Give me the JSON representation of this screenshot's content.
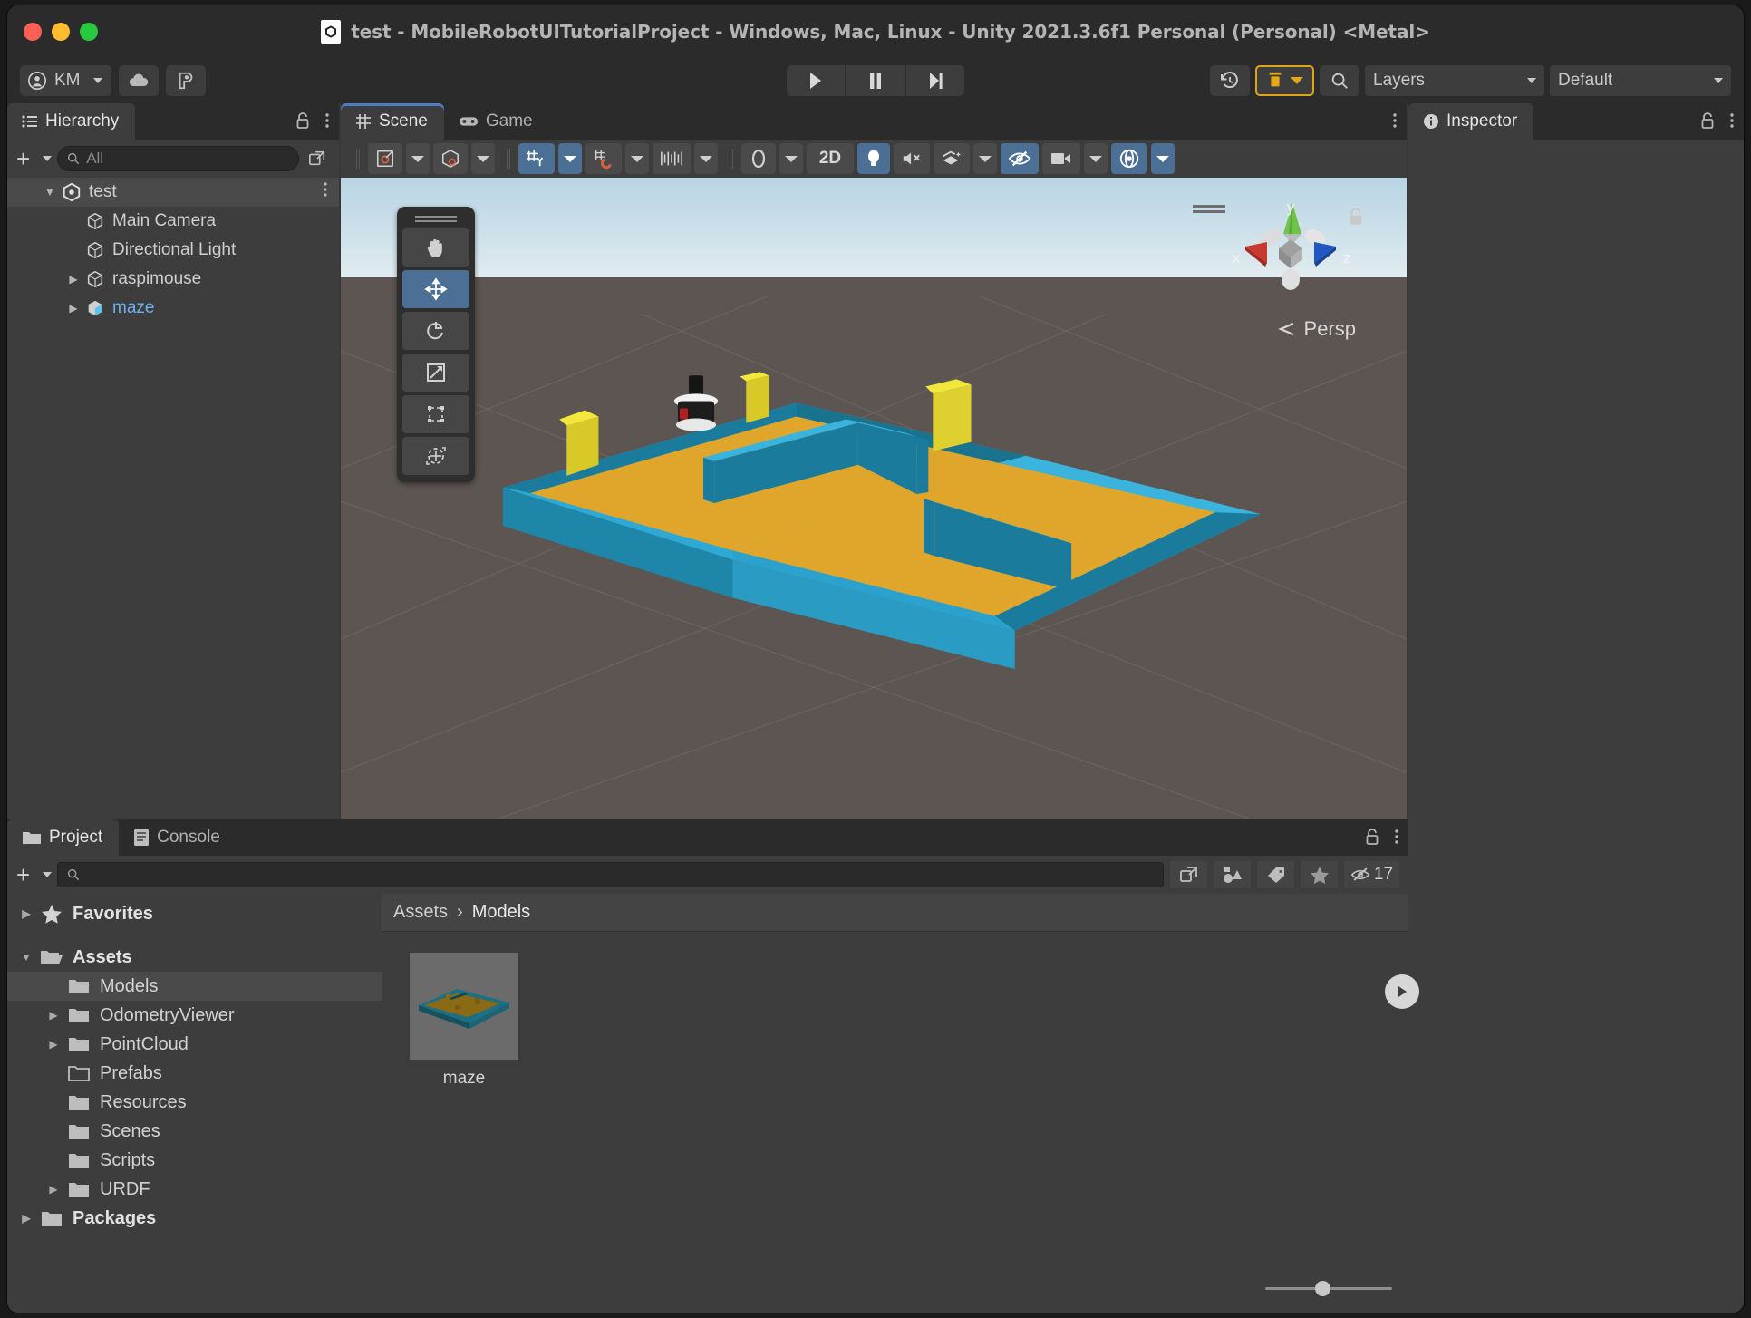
{
  "window": {
    "title": "test - MobileRobotUITutorialProject - Windows, Mac, Linux - Unity 2021.3.6f1 Personal (Personal) <Metal>",
    "doc_icon": "unity-logo-icon",
    "traffic_lights": [
      "close-red",
      "minimize-yellow",
      "zoom-green"
    ]
  },
  "toolbar": {
    "account_label": "KM",
    "account_icon": "person-icon",
    "cloud_icon": "cloud-icon",
    "collab_icon": "plastic-scm-icon",
    "play_icon": "play-icon",
    "pause_icon": "pause-icon",
    "step_icon": "step-icon",
    "undo_history_icon": "undo-history-icon",
    "layers_vis_icon": "layer-visibility-icon",
    "search_icon": "search-icon",
    "layers_label": "Layers",
    "layout_label": "Default"
  },
  "hierarchy": {
    "tab_label": "Hierarchy",
    "tab_icon": "hierarchy-icon",
    "lock_icon": "lock-open-icon",
    "menu_icon": "kebab-menu-icon",
    "add_label": "+",
    "search_placeholder": "All",
    "search_icon": "search-icon",
    "items": [
      {
        "label": "test",
        "depth": 0,
        "expanded": true,
        "arrow": "down",
        "icon": "unity-scene-icon",
        "selected": true,
        "blue": false,
        "kebab": true
      },
      {
        "label": "Main Camera",
        "depth": 1,
        "expanded": false,
        "arrow": "none",
        "icon": "gameobject-cube-icon",
        "selected": false,
        "blue": false,
        "kebab": false
      },
      {
        "label": "Directional Light",
        "depth": 1,
        "expanded": false,
        "arrow": "none",
        "icon": "gameobject-cube-icon",
        "selected": false,
        "blue": false,
        "kebab": false
      },
      {
        "label": "raspimouse",
        "depth": 1,
        "expanded": false,
        "arrow": "right",
        "icon": "gameobject-cube-icon",
        "selected": false,
        "blue": false,
        "kebab": false
      },
      {
        "label": "maze",
        "depth": 1,
        "expanded": false,
        "arrow": "right",
        "icon": "prefab-cube-icon",
        "selected": false,
        "blue": true,
        "kebab": false
      }
    ]
  },
  "scene_panel": {
    "tabs": [
      {
        "label": "Scene",
        "icon": "scene-grid-icon",
        "active": true
      },
      {
        "label": "Game",
        "icon": "gamepad-icon",
        "active": false
      }
    ],
    "menu_icon": "kebab-menu-icon",
    "tools": [
      {
        "name": "draw-mode-shaded",
        "icon": "shading-mode-icon",
        "dropdown": true,
        "active": false
      },
      {
        "name": "2d-3d-gizmos",
        "icon": "cube-gizmo-icon",
        "dropdown": true,
        "active": false
      },
      {
        "name": "grid-axis-y",
        "icon": "grid-y-icon",
        "dropdown": true,
        "active": true
      },
      {
        "name": "grid-snapping",
        "icon": "grid-magnet-icon",
        "dropdown": true,
        "active": false
      },
      {
        "name": "grid-size",
        "icon": "ruler-icon",
        "dropdown": true,
        "active": false
      },
      {
        "name": "gizmo-visibility",
        "icon": "gizmo-sphere-icon",
        "dropdown": true,
        "active": false
      },
      {
        "name": "toggle-2d",
        "icon": "2D",
        "dropdown": false,
        "active": false
      },
      {
        "name": "scene-lighting",
        "icon": "lightbulb-icon",
        "dropdown": false,
        "active": true
      },
      {
        "name": "scene-audio",
        "icon": "speaker-mute-icon",
        "dropdown": false,
        "active": false
      },
      {
        "name": "scene-fx",
        "icon": "fx-layers-icon",
        "dropdown": true,
        "active": false
      },
      {
        "name": "scene-visibility",
        "icon": "eye-slash-icon",
        "dropdown": false,
        "active": true
      },
      {
        "name": "camera-settings",
        "icon": "camera-icon",
        "dropdown": true,
        "active": false
      },
      {
        "name": "scene-gizmos",
        "icon": "gizmos-globe-icon",
        "dropdown": true,
        "active": true
      }
    ],
    "tool_palette": [
      {
        "name": "hand-tool",
        "icon": "hand-icon",
        "active": false
      },
      {
        "name": "move-tool",
        "icon": "move-arrows-icon",
        "active": true
      },
      {
        "name": "rotate-tool",
        "icon": "rotate-icon",
        "active": false
      },
      {
        "name": "scale-tool",
        "icon": "scale-icon",
        "active": false
      },
      {
        "name": "rect-tool",
        "icon": "rect-transform-icon",
        "active": false
      },
      {
        "name": "transform-tool",
        "icon": "transform-tool-icon",
        "active": false
      }
    ],
    "gizmo": {
      "x_label": "x",
      "y_label": "y",
      "z_label": "z",
      "projection_label": "Persp",
      "lock_icon": "lock-open-icon"
    },
    "scene_colors": {
      "wall_outer": "#3ab3dd",
      "wall_inner": "#1b7b9c",
      "floor": "#dfa62b",
      "marker": "#f2e83c",
      "sky_top": "#b9d4e3",
      "ground": "#5d5551"
    }
  },
  "inspector": {
    "tab_label": "Inspector",
    "tab_icon": "info-icon",
    "lock_icon": "lock-open-icon",
    "menu_icon": "kebab-menu-icon"
  },
  "project_panel": {
    "tabs": [
      {
        "label": "Project",
        "icon": "folder-icon",
        "active": true
      },
      {
        "label": "Console",
        "icon": "console-icon",
        "active": false
      }
    ],
    "lock_icon": "lock-open-icon",
    "menu_icon": "kebab-menu-icon",
    "add_label": "+",
    "search_placeholder": "",
    "search_icon": "search-icon",
    "toolbar_icons": [
      {
        "name": "open-in-new-window-icon",
        "badge": ""
      },
      {
        "name": "filter-by-type-icon",
        "badge": ""
      },
      {
        "name": "filter-by-label-icon",
        "badge": ""
      },
      {
        "name": "favorites-star-icon",
        "badge": ""
      },
      {
        "name": "hidden-packages-icon",
        "badge": "17"
      }
    ],
    "tree": [
      {
        "label": "Favorites",
        "depth": 0,
        "arrow": "right",
        "icon": "star-icon",
        "bold": true,
        "selected": false
      },
      {
        "label": "",
        "depth": 0,
        "arrow": "none",
        "icon": "spacer",
        "bold": false,
        "selected": false
      },
      {
        "label": "Assets",
        "depth": 0,
        "arrow": "down",
        "icon": "folder-open-icon",
        "bold": true,
        "selected": false
      },
      {
        "label": "Models",
        "depth": 1,
        "arrow": "none",
        "icon": "folder-icon",
        "bold": false,
        "selected": true
      },
      {
        "label": "OdometryViewer",
        "depth": 1,
        "arrow": "right",
        "icon": "folder-icon",
        "bold": false,
        "selected": false
      },
      {
        "label": "PointCloud",
        "depth": 1,
        "arrow": "right",
        "icon": "folder-icon",
        "bold": false,
        "selected": false
      },
      {
        "label": "Prefabs",
        "depth": 1,
        "arrow": "none",
        "icon": "folder-empty-icon",
        "bold": false,
        "selected": false
      },
      {
        "label": "Resources",
        "depth": 1,
        "arrow": "none",
        "icon": "folder-icon",
        "bold": false,
        "selected": false
      },
      {
        "label": "Scenes",
        "depth": 1,
        "arrow": "none",
        "icon": "folder-icon",
        "bold": false,
        "selected": false
      },
      {
        "label": "Scripts",
        "depth": 1,
        "arrow": "none",
        "icon": "folder-icon",
        "bold": false,
        "selected": false
      },
      {
        "label": "URDF",
        "depth": 1,
        "arrow": "right",
        "icon": "folder-icon",
        "bold": false,
        "selected": false
      },
      {
        "label": "Packages",
        "depth": 0,
        "arrow": "right",
        "icon": "folder-icon",
        "bold": true,
        "selected": false
      }
    ],
    "breadcrumb": {
      "root": "Assets",
      "separator": "›",
      "current": "Models"
    },
    "assets": [
      {
        "name": "maze",
        "type": "model",
        "has_preview_play": true
      }
    ],
    "zoom_slider_value": 45
  }
}
